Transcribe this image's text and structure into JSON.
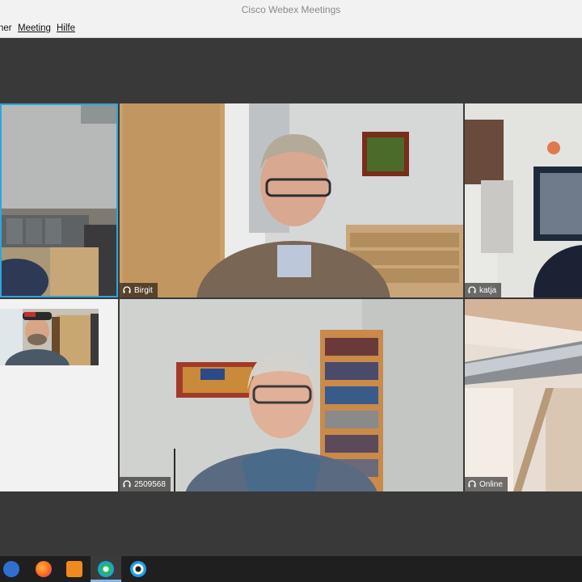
{
  "window": {
    "title": "Cisco Webex Meetings"
  },
  "menu": {
    "items": [
      "ner",
      "Meeting",
      "Hilfe"
    ]
  },
  "participants": {
    "birgit": {
      "name": "Birgit"
    },
    "katja": {
      "name": "katja"
    },
    "p2509568": {
      "name": "2509568"
    },
    "online": {
      "name": "Online"
    }
  },
  "colors": {
    "active_speaker_border": "#2fa6d8",
    "taskbar": "#1f1f1f",
    "stage": "#393939"
  },
  "taskbar": {
    "icons": [
      "webex-app-icon",
      "firefox-icon",
      "office-icon",
      "webex-active-icon",
      "webex-meetings-icon"
    ]
  }
}
